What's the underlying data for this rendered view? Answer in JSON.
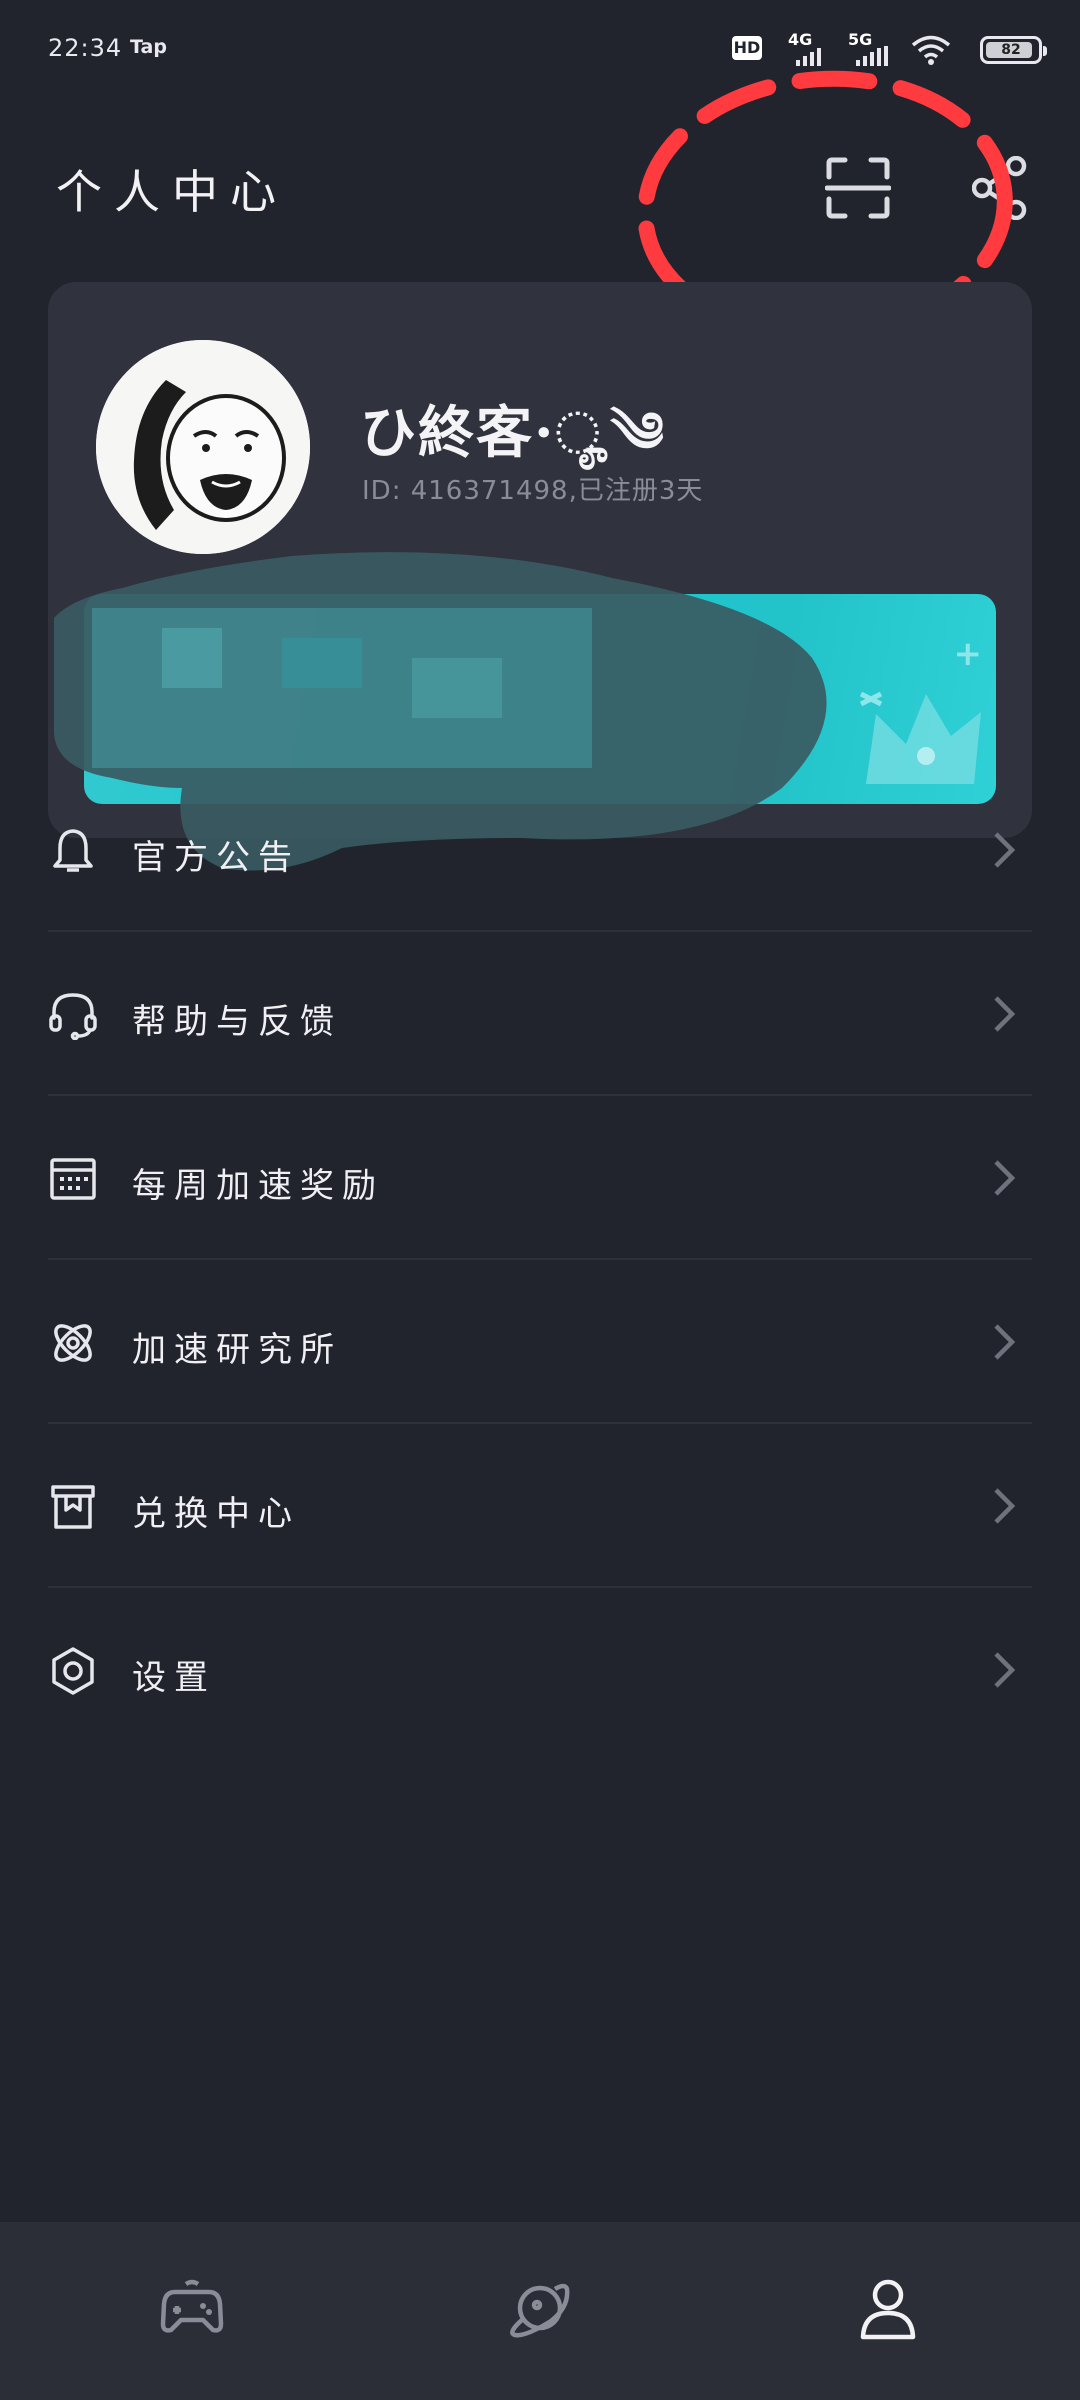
{
  "status_bar": {
    "time": "22:34",
    "app_indicator": "Tap",
    "hd_badge": "HD",
    "network_1": "4G",
    "network_2": "5G",
    "battery": "82",
    "icons": [
      "hd-icon",
      "signal-icon",
      "signal-icon",
      "wifi-icon",
      "battery-icon"
    ]
  },
  "header": {
    "title": "个人中心",
    "actions": [
      "scan-icon",
      "share-icon"
    ],
    "annotation_color": "#ff3b3f"
  },
  "profile": {
    "username": "ひ終客·ೄ༄",
    "user_id": "ID: 416371498,已注册3天",
    "banner_color": "#1ccad0"
  },
  "menu": {
    "items": [
      {
        "label": "官方公告",
        "icon": "bell-icon"
      },
      {
        "label": "帮助与反馈",
        "icon": "headset-icon"
      },
      {
        "label": "每周加速奖励",
        "icon": "calendar-icon"
      },
      {
        "label": "加速研究所",
        "icon": "atom-icon"
      },
      {
        "label": "兑换中心",
        "icon": "gift-box-icon"
      },
      {
        "label": "设置",
        "icon": "settings-icon"
      }
    ]
  },
  "bottom_nav": {
    "tabs": [
      {
        "icon": "gamepad-icon",
        "active": false
      },
      {
        "icon": "planet-icon",
        "active": false
      },
      {
        "icon": "profile-icon",
        "active": true
      }
    ]
  }
}
